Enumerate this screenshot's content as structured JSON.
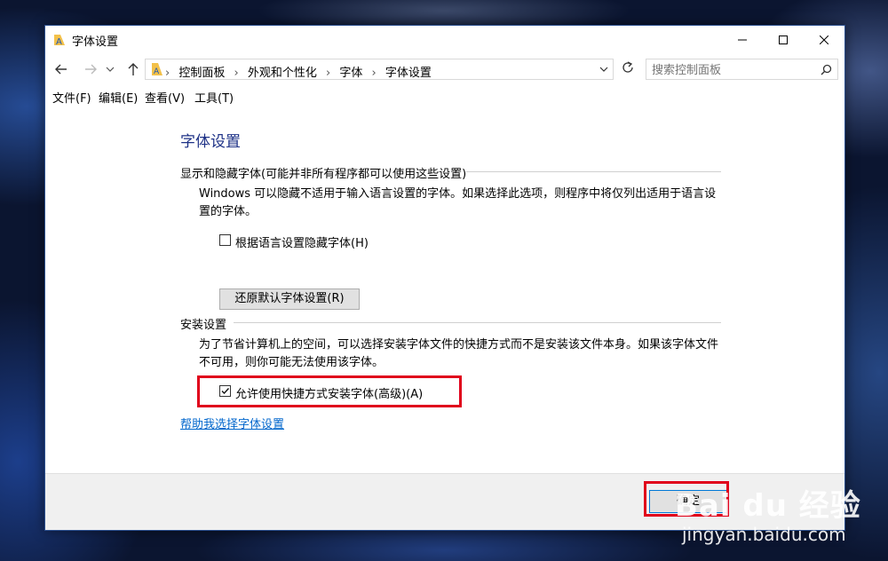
{
  "window": {
    "title": "字体设置",
    "controls": {
      "minimize": "minimize",
      "maximize": "maximize",
      "close": "close"
    }
  },
  "nav": {
    "breadcrumbs": [
      "控制面板",
      "外观和个性化",
      "字体",
      "字体设置"
    ],
    "search_placeholder": "搜索控制面板"
  },
  "menu": {
    "items": [
      "文件(F)",
      "编辑(E)",
      "查看(V)",
      "工具(T)"
    ]
  },
  "main": {
    "title": "字体设置",
    "show_hide": {
      "header": "显示和隐藏字体(可能并非所有程序都可以使用这些设置)",
      "description": "Windows 可以隐藏不适用于输入语言设置的字体。如果选择此选项，则程序中将仅列出适用于语言设置的字体。",
      "checkbox_label": "根据语言设置隐藏字体(H)",
      "checkbox_checked": false,
      "restore_button": "还原默认字体设置(R)"
    },
    "install": {
      "header": "安装设置",
      "description": "为了节省计算机上的空间，可以选择安装字体文件的快捷方式而不是安装该文件本身。如果该字体文件不可用，则你可能无法使用该字体。",
      "checkbox_label": "允许使用快捷方式安装字体(高级)(A)",
      "checkbox_checked": true
    },
    "help_link": "帮助我选择字体设置"
  },
  "footer": {
    "ok_button": "确定"
  },
  "watermark": {
    "brand": "Bai du 经验",
    "url": "jingyan.baidu.com"
  },
  "colors": {
    "highlight": "#e0001b",
    "title_blue": "#1e3287",
    "link_blue": "#0066cc"
  }
}
